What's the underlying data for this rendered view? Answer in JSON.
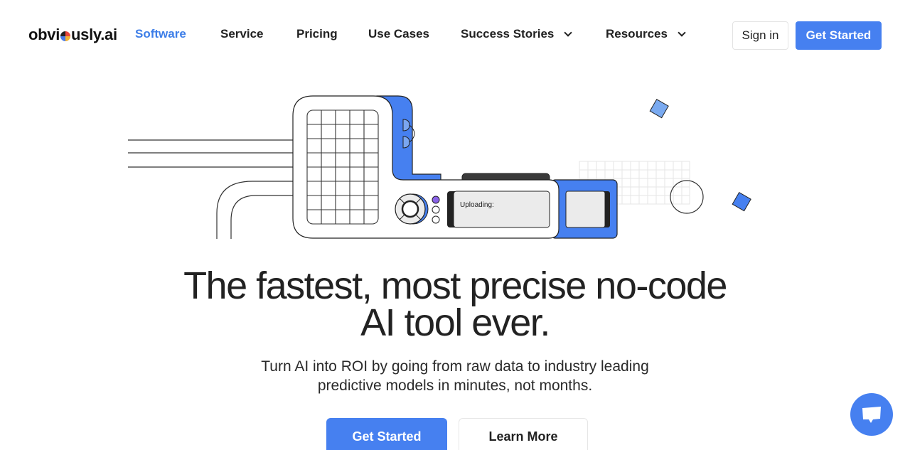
{
  "brand": {
    "logo_prefix": "obvi",
    "logo_suffix": "usly.ai",
    "accent_color": "#4680f0"
  },
  "nav": {
    "items": [
      {
        "label": "Software",
        "active": true,
        "has_dropdown": false
      },
      {
        "label": "Service",
        "active": false,
        "has_dropdown": false
      },
      {
        "label": "Pricing",
        "active": false,
        "has_dropdown": false
      },
      {
        "label": "Use Cases",
        "active": false,
        "has_dropdown": false
      },
      {
        "label": "Success Stories",
        "active": false,
        "has_dropdown": true
      },
      {
        "label": "Resources",
        "active": false,
        "has_dropdown": true
      }
    ],
    "sign_in_label": "Sign in",
    "get_started_label": "Get Started"
  },
  "illustration": {
    "screen_text": "Uploading:"
  },
  "hero": {
    "title": "The fastest, most precise no-code AI tool ever.",
    "subtitle": "Turn AI into ROI by going from raw data to industry leading predictive models in minutes, not months.",
    "primary_cta": "Get Started",
    "secondary_cta": "Learn More"
  },
  "chat": {
    "icon": "chat-bubble-icon"
  }
}
